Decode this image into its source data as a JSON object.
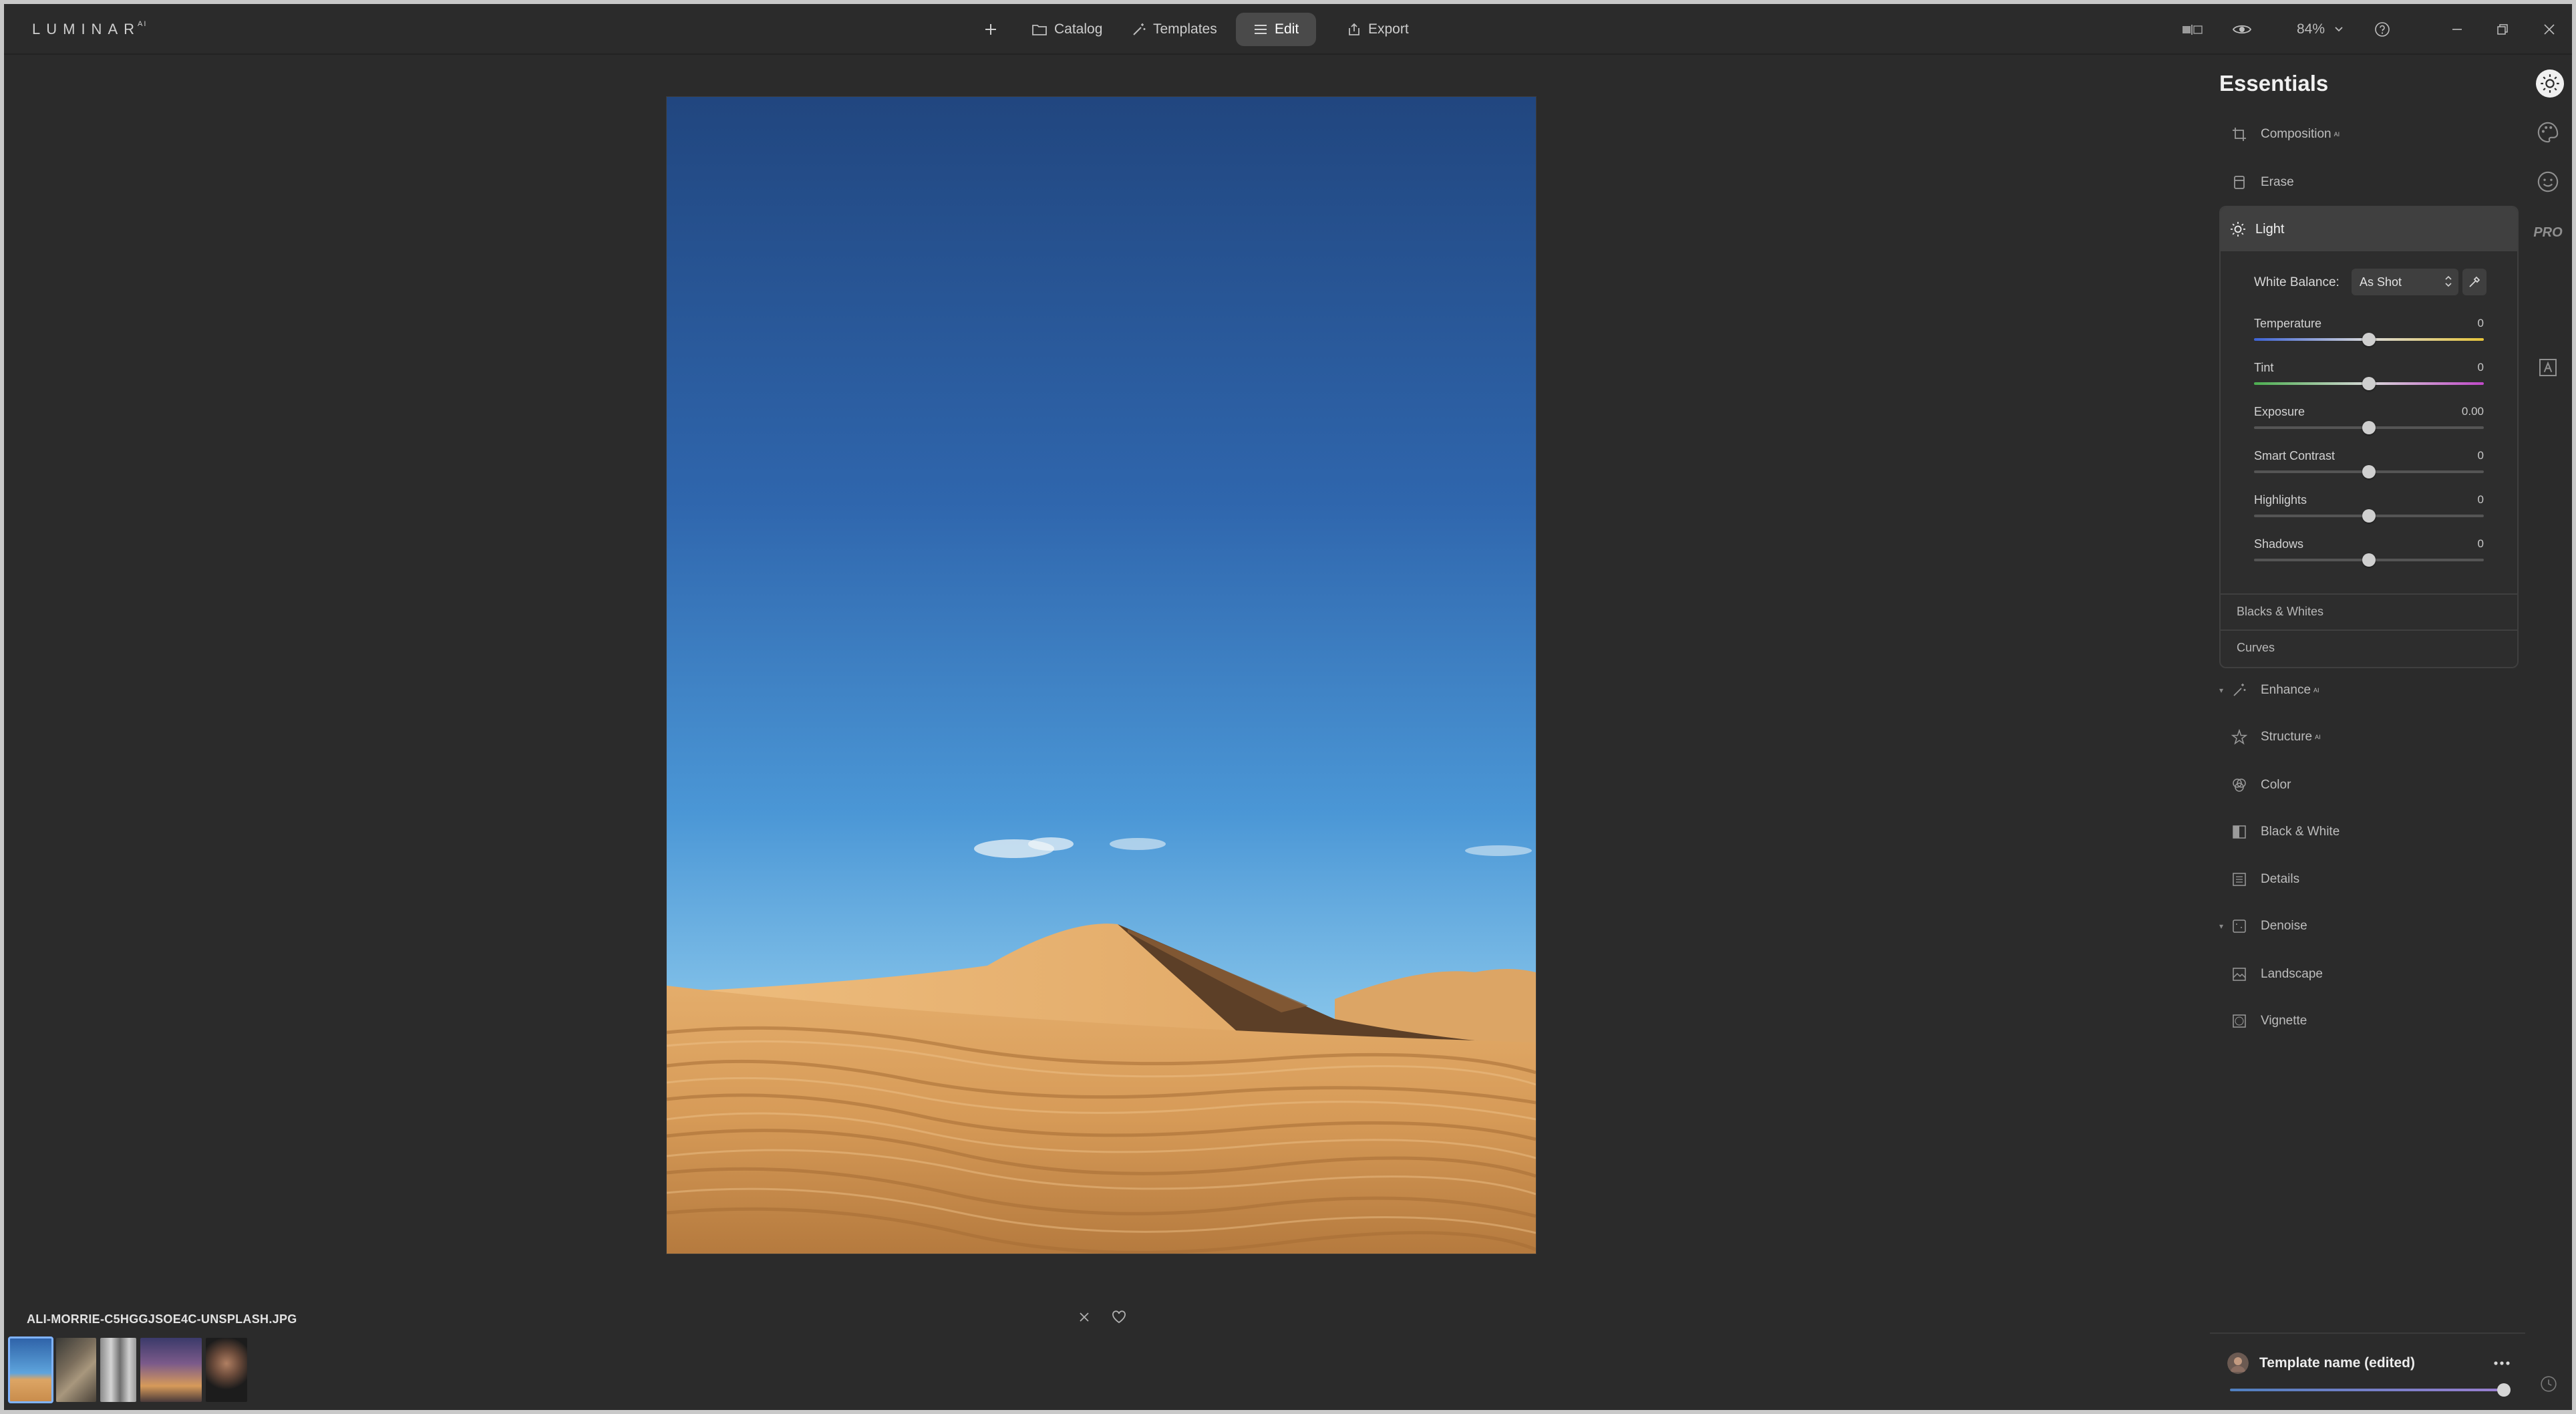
{
  "app": {
    "logo": "LUMINAR",
    "logo_sup": "AI"
  },
  "nav": {
    "add_icon": "plus-icon",
    "catalog": "Catalog",
    "templates": "Templates",
    "edit": "Edit",
    "export": "Export"
  },
  "top_right": {
    "zoom": "84%"
  },
  "essentials": {
    "title": "Essentials",
    "composition": "Composition",
    "composition_sup": "AI",
    "erase": "Erase",
    "light": {
      "title": "Light",
      "white_balance_label": "White Balance:",
      "white_balance_value": "As Shot",
      "sliders": [
        {
          "label": "Temperature",
          "value": "0",
          "position": 0.5,
          "track": "temperature"
        },
        {
          "label": "Tint",
          "value": "0",
          "position": 0.5,
          "track": "tint"
        },
        {
          "label": "Exposure",
          "value": "0.00",
          "position": 0.5,
          "track": "plain"
        },
        {
          "label": "Smart Contrast",
          "value": "0",
          "position": 0.5,
          "track": "plain"
        },
        {
          "label": "Highlights",
          "value": "0",
          "position": 0.5,
          "track": "plain"
        },
        {
          "label": "Shadows",
          "value": "0",
          "position": 0.5,
          "track": "plain"
        }
      ],
      "blacks_whites": "Blacks & Whites",
      "curves": "Curves"
    },
    "tools": [
      {
        "label": "Enhance",
        "sup": "AI",
        "icon": "enhance-icon",
        "caret": true
      },
      {
        "label": "Structure",
        "sup": "AI",
        "icon": "structure-icon",
        "caret": false
      },
      {
        "label": "Color",
        "sup": "",
        "icon": "color-icon",
        "caret": false
      },
      {
        "label": "Black & White",
        "sup": "",
        "icon": "black-white-icon",
        "caret": false
      },
      {
        "label": "Details",
        "sup": "",
        "icon": "details-icon",
        "caret": false
      },
      {
        "label": "Denoise",
        "sup": "",
        "icon": "denoise-icon",
        "caret": true
      },
      {
        "label": "Landscape",
        "sup": "",
        "icon": "landscape-icon",
        "caret": false
      },
      {
        "label": "Vignette",
        "sup": "",
        "icon": "vignette-icon",
        "caret": false
      }
    ]
  },
  "side_icons": [
    "essentials-sun-icon",
    "creative-palette-icon",
    "portrait-face-icon",
    "pro-icon",
    "local-masking-icon"
  ],
  "side_pro_label": "PRO",
  "bottom": {
    "filename": "ALI-MORRIE-C5HGGJSOE4C-UNSPLASH.JPG",
    "template_name": "Template name (edited)",
    "template_amount": 1.0
  },
  "colors": {
    "background": "#2b2b2b",
    "panel_header": "#404040",
    "accent_selected": "#7fb3ff"
  }
}
